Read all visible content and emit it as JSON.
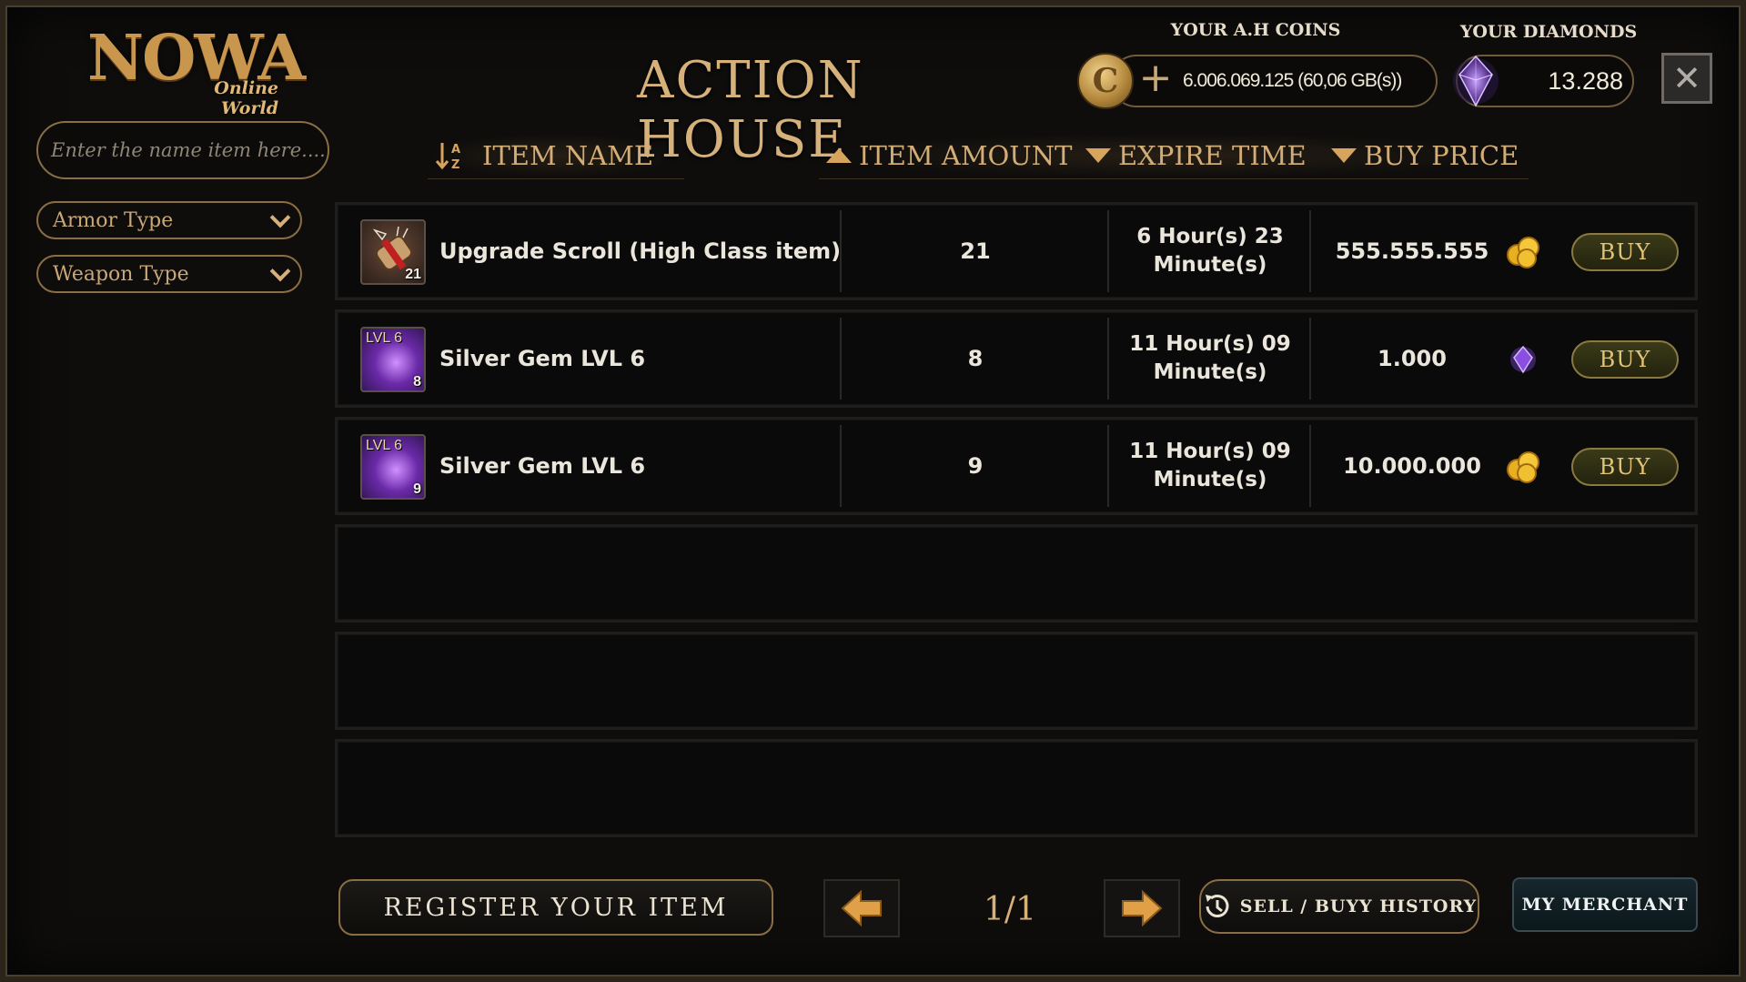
{
  "logo": {
    "main": "NOWA",
    "sub": "Online World"
  },
  "search": {
    "placeholder": "Enter the name item here...."
  },
  "filters": [
    {
      "label": "Armor Type"
    },
    {
      "label": "Weapon Type"
    }
  ],
  "title": "ACTION HOUSE",
  "currency": {
    "coins_label": "YOUR A.H COINS",
    "coins_value": "6.006.069.125 (60,06 GB(s))",
    "coin_icon_letter": "C",
    "plus": "+",
    "diamonds_label": "YOUR DIAMONDS",
    "diamonds_value": "13.288"
  },
  "close": "✕",
  "columns": {
    "item_name": "ITEM NAME",
    "item_amount": "ITEM AMOUNT",
    "expire_time": "EXPIRE TIME",
    "buy_price": "BUY PRICE"
  },
  "listings": [
    {
      "name": "Upgrade Scroll (High Class item)",
      "qty_badge": "21",
      "level_badge": "",
      "icon": "scroll-icon",
      "amount": "21",
      "expire_line1": "6 Hour(s) 23",
      "expire_line2": "Minute(s)",
      "price": "555.555.555",
      "currency": "coin",
      "buy": "BUY"
    },
    {
      "name": "Silver Gem LVL 6",
      "qty_badge": "8",
      "level_badge": "LVL 6",
      "icon": "gem-icon",
      "amount": "8",
      "expire_line1": "11 Hour(s) 09",
      "expire_line2": "Minute(s)",
      "price": "1.000",
      "currency": "diamond",
      "buy": "BUY"
    },
    {
      "name": "Silver Gem LVL 6",
      "qty_badge": "9",
      "level_badge": "LVL 6",
      "icon": "gem-icon",
      "amount": "9",
      "expire_line1": "11 Hour(s) 09",
      "expire_line2": "Minute(s)",
      "price": "10.000.000",
      "currency": "coin",
      "buy": "BUY"
    }
  ],
  "footer": {
    "register": "REGISTER YOUR ITEM",
    "page": "1/1",
    "history": "SELL / BUYY HISTORY",
    "merchant": "MY MERCHANT"
  },
  "colors": {
    "gold": "#d6b27a",
    "accent_border": "#8a6e44",
    "buy_bg": "#2e2e14",
    "diamond": "#8a4fe0"
  }
}
